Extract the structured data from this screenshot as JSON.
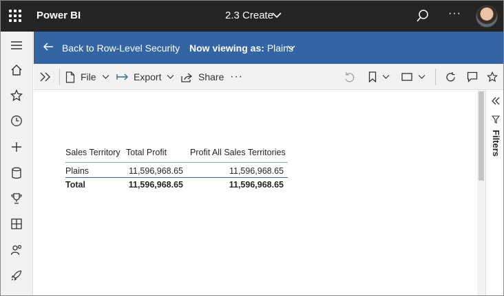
{
  "topbar": {
    "app_title": "Power BI",
    "report_name": "2.3 Create",
    "icons": [
      "app-launcher-icon",
      "chevron-down-icon",
      "search-icon",
      "more-icon",
      "avatar"
    ]
  },
  "leftnav": {
    "items": [
      "hamburger-icon",
      "home-icon",
      "favorites-icon",
      "recent-icon",
      "create-icon",
      "datasets-icon",
      "goals-icon",
      "apps-icon",
      "shared-icon",
      "learn-icon"
    ]
  },
  "banner": {
    "back_label": "Back to Row-Level Security",
    "viewing_prefix": "Now viewing as:",
    "viewing_role": "Plains",
    "color": "#3364a3"
  },
  "cmdbar": {
    "file_label": "File",
    "export_label": "Export",
    "share_label": "Share",
    "more": "···"
  },
  "table": {
    "headers": [
      "Sales Territory",
      "Total Profit",
      "Profit All Sales Territories"
    ],
    "rows": [
      [
        "Plains",
        "11,596,968.65",
        "11,596,968.65"
      ]
    ],
    "total": [
      "Total",
      "11,596,968.65",
      "11,596,968.65"
    ]
  },
  "filters": {
    "label": "Filters"
  },
  "colors": {
    "topbar": "#252423",
    "banner": "#3364a3",
    "chrome": "#f3f2f1"
  }
}
